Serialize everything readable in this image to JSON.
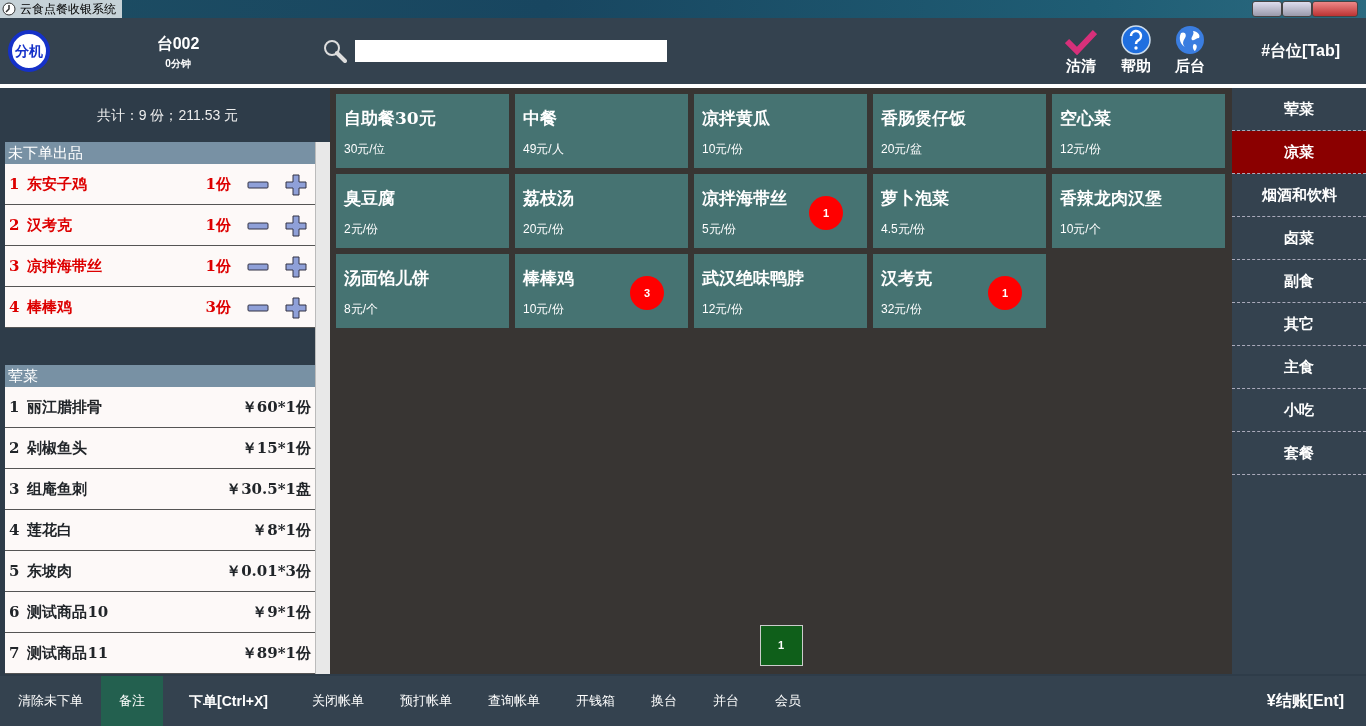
{
  "window": {
    "title": "云食点餐收银系统"
  },
  "header": {
    "logo": "分机",
    "table_name": "台002",
    "elapsed": "0分钟",
    "actions": [
      {
        "label": "沽清",
        "kind": "check"
      },
      {
        "label": "帮助",
        "kind": "help"
      },
      {
        "label": "后台",
        "kind": "globe"
      }
    ],
    "tab_hint": "#台位[Tab]"
  },
  "order": {
    "summary": "共计：9 份；211.53 元",
    "pending": {
      "title": "未下单出品",
      "items": [
        {
          "index": "1",
          "name": "东安子鸡",
          "qty": "1份"
        },
        {
          "index": "2",
          "name": "汉考克",
          "qty": "1份"
        },
        {
          "index": "3",
          "name": "凉拌海带丝",
          "qty": "1份"
        },
        {
          "index": "4",
          "name": "棒棒鸡",
          "qty": "3份"
        }
      ]
    },
    "ordered": {
      "title": "荤菜",
      "items": [
        {
          "index": "1",
          "name": "丽江腊排骨",
          "price": "￥60*1份"
        },
        {
          "index": "2",
          "name": "剁椒鱼头",
          "price": "￥15*1份"
        },
        {
          "index": "3",
          "name": "组庵鱼刺",
          "price": "￥30.5*1盘"
        },
        {
          "index": "4",
          "name": "莲花白",
          "price": "￥8*1份"
        },
        {
          "index": "5",
          "name": "东坡肉",
          "price": "￥0.01*3份"
        },
        {
          "index": "6",
          "name": "测试商品10",
          "price": "￥9*1份"
        },
        {
          "index": "7",
          "name": "测试商品11",
          "price": "￥89*1份"
        }
      ]
    }
  },
  "dishes": [
    {
      "name": "自助餐30元",
      "price": "30元/位"
    },
    {
      "name": "中餐",
      "price": "49元/人"
    },
    {
      "name": "凉拌黄瓜",
      "price": "10元/份"
    },
    {
      "name": "香肠煲仔饭",
      "price": "20元/盆"
    },
    {
      "name": "空心菜",
      "price": "12元/份"
    },
    {
      "name": "臭豆腐",
      "price": "2元/份"
    },
    {
      "name": "荔枝汤",
      "price": "20元/份"
    },
    {
      "name": "凉拌海带丝",
      "price": "5元/份",
      "count": "1"
    },
    {
      "name": "萝卜泡菜",
      "price": "4.5元/份"
    },
    {
      "name": "香辣龙肉汉堡",
      "price": "10元/个"
    },
    {
      "name": "汤面馅儿饼",
      "price": "8元/个"
    },
    {
      "name": "棒棒鸡",
      "price": "10元/份",
      "count": "3"
    },
    {
      "name": "武汉绝味鸭脖",
      "price": "12元/份"
    },
    {
      "name": "汉考克",
      "price": "32元/份",
      "count": "1"
    }
  ],
  "pages": [
    {
      "label": "1",
      "selected": true
    }
  ],
  "categories": [
    {
      "label": "荤菜",
      "selected": false
    },
    {
      "label": "凉菜",
      "selected": true
    },
    {
      "label": "烟酒和饮料",
      "selected": false
    },
    {
      "label": "卤菜",
      "selected": false
    },
    {
      "label": "副食",
      "selected": false
    },
    {
      "label": "其它",
      "selected": false
    },
    {
      "label": "主食",
      "selected": false
    },
    {
      "label": "小吃",
      "selected": false
    },
    {
      "label": "套餐",
      "selected": false
    }
  ],
  "footer": {
    "buttons": [
      {
        "label": "清除未下单",
        "selected": false,
        "kind": "plain"
      },
      {
        "label": "备注",
        "selected": true,
        "kind": "plain"
      },
      {
        "label": "下单[Ctrl+X]",
        "selected": false,
        "kind": "primary"
      },
      {
        "label": "关闭帐单",
        "selected": false,
        "kind": "plain"
      },
      {
        "label": "预打帐单",
        "selected": false,
        "kind": "plain"
      },
      {
        "label": "查询帐单",
        "selected": false,
        "kind": "plain"
      },
      {
        "label": "开钱箱",
        "selected": false,
        "kind": "plain"
      },
      {
        "label": "换台",
        "selected": false,
        "kind": "plain"
      },
      {
        "label": "并台",
        "selected": false,
        "kind": "plain"
      },
      {
        "label": "会员",
        "selected": false,
        "kind": "plain"
      }
    ],
    "checkout": "¥结账[Ent]"
  }
}
